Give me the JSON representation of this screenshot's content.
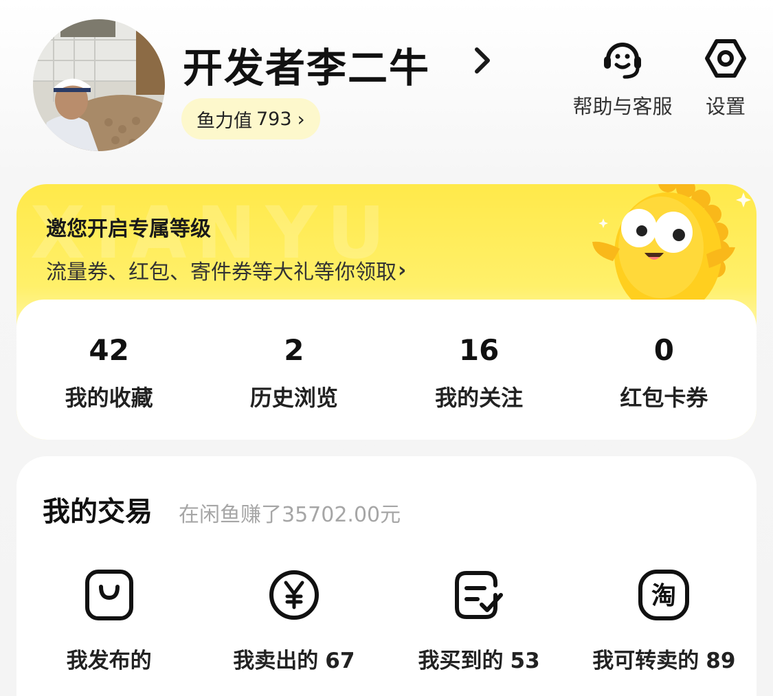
{
  "profile": {
    "name": "开发者李二牛",
    "fish_power_label": "鱼力值",
    "fish_power_value": "793"
  },
  "header_actions": {
    "help_label": "帮助与客服",
    "settings_label": "设置"
  },
  "banner": {
    "watermark": "XIANYU",
    "title": "邀您开启专属等级",
    "subtitle": "流量券、红包、寄件券等大礼等你领取"
  },
  "stats": [
    {
      "value": "42",
      "label": "我的收藏"
    },
    {
      "value": "2",
      "label": "历史浏览"
    },
    {
      "value": "16",
      "label": "我的关注"
    },
    {
      "value": "0",
      "label": "红包卡券"
    }
  ],
  "trades": {
    "title": "我的交易",
    "earned_text": "在闲鱼赚了35702.00元",
    "items": [
      {
        "label": "我发布的",
        "count": "",
        "icon": "bag-icon"
      },
      {
        "label": "我卖出的",
        "count": "67",
        "icon": "yen-icon"
      },
      {
        "label": "我买到的",
        "count": "53",
        "icon": "order-check-icon"
      },
      {
        "label": "我可转卖的",
        "count": "89",
        "icon": "tao-icon"
      }
    ]
  },
  "colors": {
    "accent_yellow": "#ffe94a",
    "chip_bg": "#fdf8cc",
    "muted_text": "#a6a6a6"
  }
}
